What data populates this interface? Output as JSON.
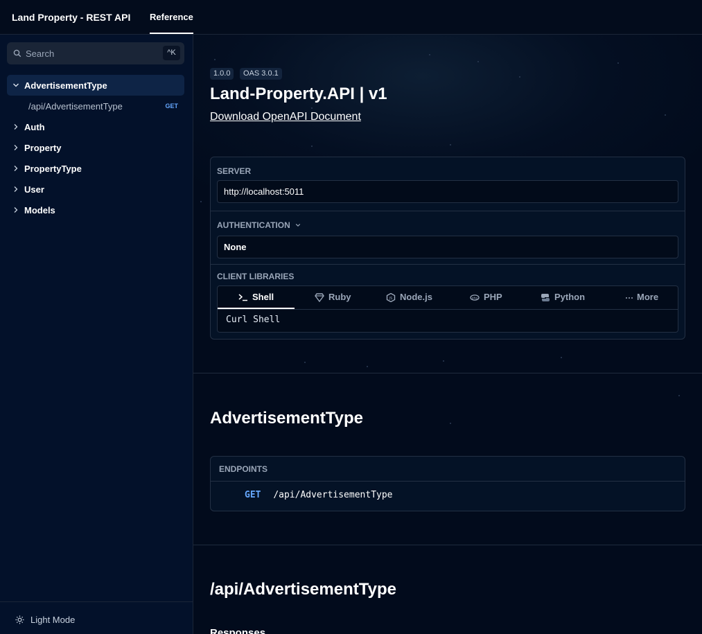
{
  "header": {
    "app_title": "Land Property - REST API",
    "reference_tab": "Reference"
  },
  "sidebar": {
    "search_placeholder": "Search",
    "search_shortcut": "^K",
    "items": [
      {
        "label": "AdvertisementType",
        "expanded": true,
        "active": true
      },
      {
        "label": "Auth"
      },
      {
        "label": "Property"
      },
      {
        "label": "PropertyType"
      },
      {
        "label": "User"
      },
      {
        "label": "Models"
      }
    ],
    "sub_item": {
      "label": "/api/AdvertisementType",
      "method": "GET"
    },
    "footer_label": "Light Mode"
  },
  "main": {
    "version_badge": "1.0.0",
    "oas_badge": "OAS 3.0.1",
    "title": "Land-Property.API | v1",
    "download_link": "Download OpenAPI Document",
    "server": {
      "label": "SERVER",
      "value": "http://localhost:5011"
    },
    "auth": {
      "label": "AUTHENTICATION",
      "value": "None"
    },
    "client_libraries": {
      "label": "CLIENT LIBRARIES",
      "tabs": [
        {
          "label": "Shell",
          "icon": "terminal-icon",
          "active": true
        },
        {
          "label": "Ruby",
          "icon": "ruby-icon"
        },
        {
          "label": "Node.js",
          "icon": "nodejs-icon"
        },
        {
          "label": "PHP",
          "icon": "php-icon"
        },
        {
          "label": "Python",
          "icon": "python-icon"
        },
        {
          "label": "More",
          "icon": "more-icon"
        }
      ],
      "selected_client": "Curl Shell"
    },
    "section_title": "AdvertisementType",
    "endpoints": {
      "label": "ENDPOINTS",
      "rows": [
        {
          "method": "GET",
          "path": "/api/AdvertisementType"
        }
      ]
    },
    "operation_title": "/api/AdvertisementType",
    "responses_label": "Responses"
  },
  "colors": {
    "background": "#020b1c",
    "sidebar": "#03112a",
    "active_nav": "#0e2446",
    "get_method": "#66a8ff",
    "border": "#233044"
  }
}
